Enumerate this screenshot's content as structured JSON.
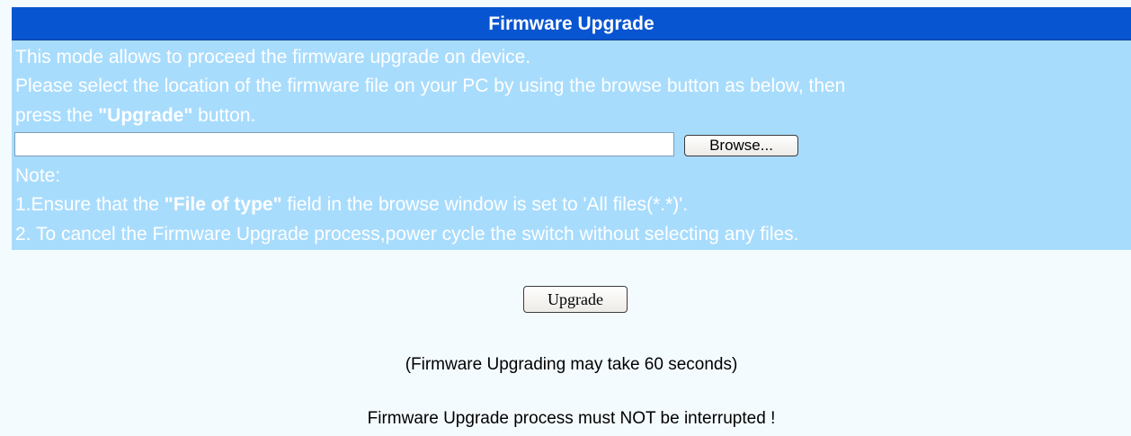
{
  "panel": {
    "title": "Firmware Upgrade",
    "line1": "This mode allows to proceed the firmware upgrade on device.",
    "line2": "Please select the location of the firmware file on your PC by using the browse button as below, then",
    "line3_prefix": "press the ",
    "line3_bold": "\"Upgrade\"",
    "line3_suffix": " button.",
    "file_input_value": "",
    "browse_label": "Browse...",
    "note_label": "Note:",
    "note1_prefix": "1.Ensure that the ",
    "note1_bold": "\"File of type\"",
    "note1_suffix": " field in the browse window is set to 'All files(*.*)'.",
    "note2": "2. To cancel the Firmware Upgrade process,power cycle the switch without selecting any files."
  },
  "actions": {
    "upgrade_label": "Upgrade"
  },
  "messages": {
    "duration": "(Firmware Upgrading may take 60 seconds)",
    "warning": "Firmware Upgrade process must NOT be interrupted !"
  },
  "colors": {
    "title_bar": "#0855d1",
    "panel_bg": "#a8dcfd",
    "page_bg": "#f4fbff"
  }
}
